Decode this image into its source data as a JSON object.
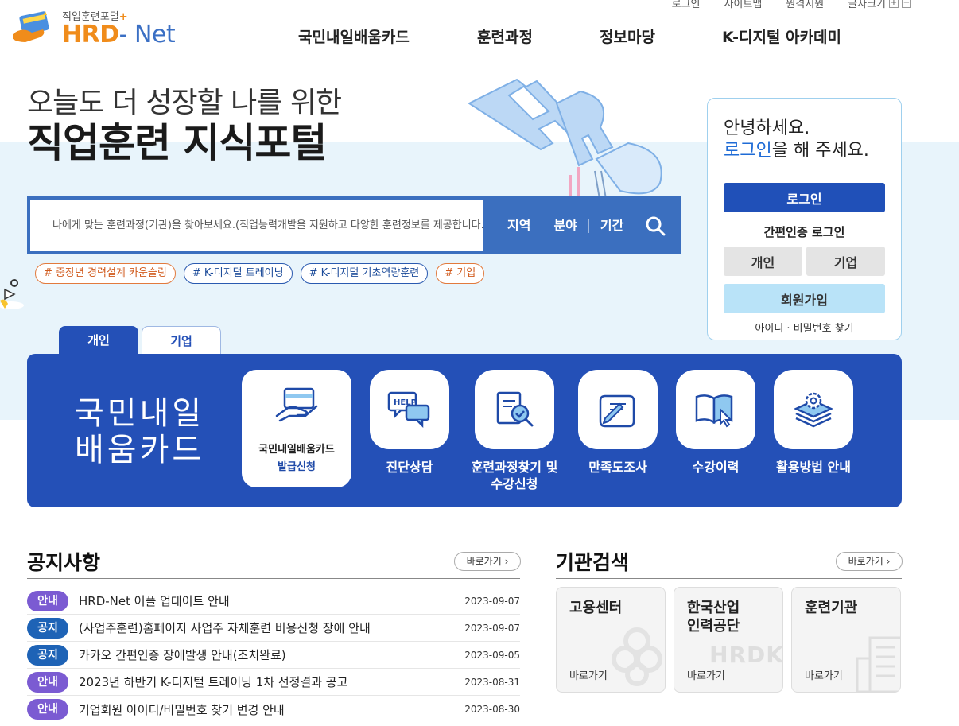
{
  "utility": {
    "login": "로그인",
    "sitemap": "사이트맵",
    "remote": "원격지원",
    "font_size": "글자크기",
    "font_plus": "+",
    "font_minus": "−"
  },
  "logo": {
    "sub": "직업훈련포털",
    "sub_plus": "+",
    "main": "HRD",
    "main_dash": "- Net"
  },
  "gnb": [
    "국민내일배움카드",
    "훈련과정",
    "정보마당",
    "K-디지털 아카데미"
  ],
  "hero": {
    "subtitle": "오늘도 더 성장할 나를 위한",
    "title": "직업훈련 지식포털"
  },
  "search": {
    "placeholder": "나에게 맞는 훈련과정(기관)을 찾아보세요.(직업능력개발을 지원하고 다양한 훈련정보를 제공합니다.)",
    "filters": [
      "지역",
      "분야",
      "기간"
    ]
  },
  "tags": [
    "# 중장년 경력설계 카운슬링",
    "# K-디지털 트레이닝",
    "# K-디지털 기초역량훈련",
    "# 기업"
  ],
  "login_box": {
    "hello": "안녕하세요.",
    "login_word": "로그인",
    "hello_rest": "을 해 주세요.",
    "login_button": "로그인",
    "easy_title": "간편인증 로그인",
    "easy_personal": "개인",
    "easy_company": "기업",
    "join": "회원가입",
    "find": "아이디 · 비밀번호 찾기"
  },
  "tabs": [
    "개인",
    "기업"
  ],
  "panel": {
    "title_line1": "국민내일",
    "title_line2": "배움카드",
    "main_service_l1": "국민내일배움카드",
    "main_service_l2": "발급신청",
    "services": [
      {
        "label": "진단상담"
      },
      {
        "label": "훈련과정찾기 및",
        "label2": "수강신청"
      },
      {
        "label": "만족도조사"
      },
      {
        "label": "수강이력"
      },
      {
        "label": "활용방법 안내"
      }
    ]
  },
  "notices": {
    "title": "공지사항",
    "more": "바로가기",
    "items": [
      {
        "badge": "안내",
        "text": "HRD-Net 어플 업데이트 안내",
        "date": "2023-09-07"
      },
      {
        "badge": "공지",
        "text": "(사업주훈련)홈페이지 사업주 자체훈련 비용신청 장애 안내",
        "date": "2023-09-07"
      },
      {
        "badge": "공지",
        "text": "카카오 간편인증 장애발생 안내(조치완료)",
        "date": "2023-09-05"
      },
      {
        "badge": "안내",
        "text": "2023년 하반기 K-디지털 트레이닝 1차 선정결과 공고",
        "date": "2023-08-31"
      },
      {
        "badge": "안내",
        "text": "기업회원 아이디/비밀번호 찾기 변경 안내",
        "date": "2023-08-30"
      }
    ]
  },
  "orgs": {
    "title": "기관검색",
    "more": "바로가기",
    "cards": [
      {
        "name": "고용센터",
        "link": "바로가기"
      },
      {
        "name1": "한국산업",
        "name2": "인력공단",
        "link": "바로가기",
        "watermark": "HRDK"
      },
      {
        "name": "훈련기관",
        "link": "바로가기"
      }
    ]
  },
  "colors": {
    "primary_blue": "#2450b7",
    "search_blue": "#3b6fbf",
    "orange": "#f08c1b",
    "badge_purple": "#7b5bd2",
    "badge_blue": "#1e63b6",
    "light_blue": "#b9e3f8"
  }
}
